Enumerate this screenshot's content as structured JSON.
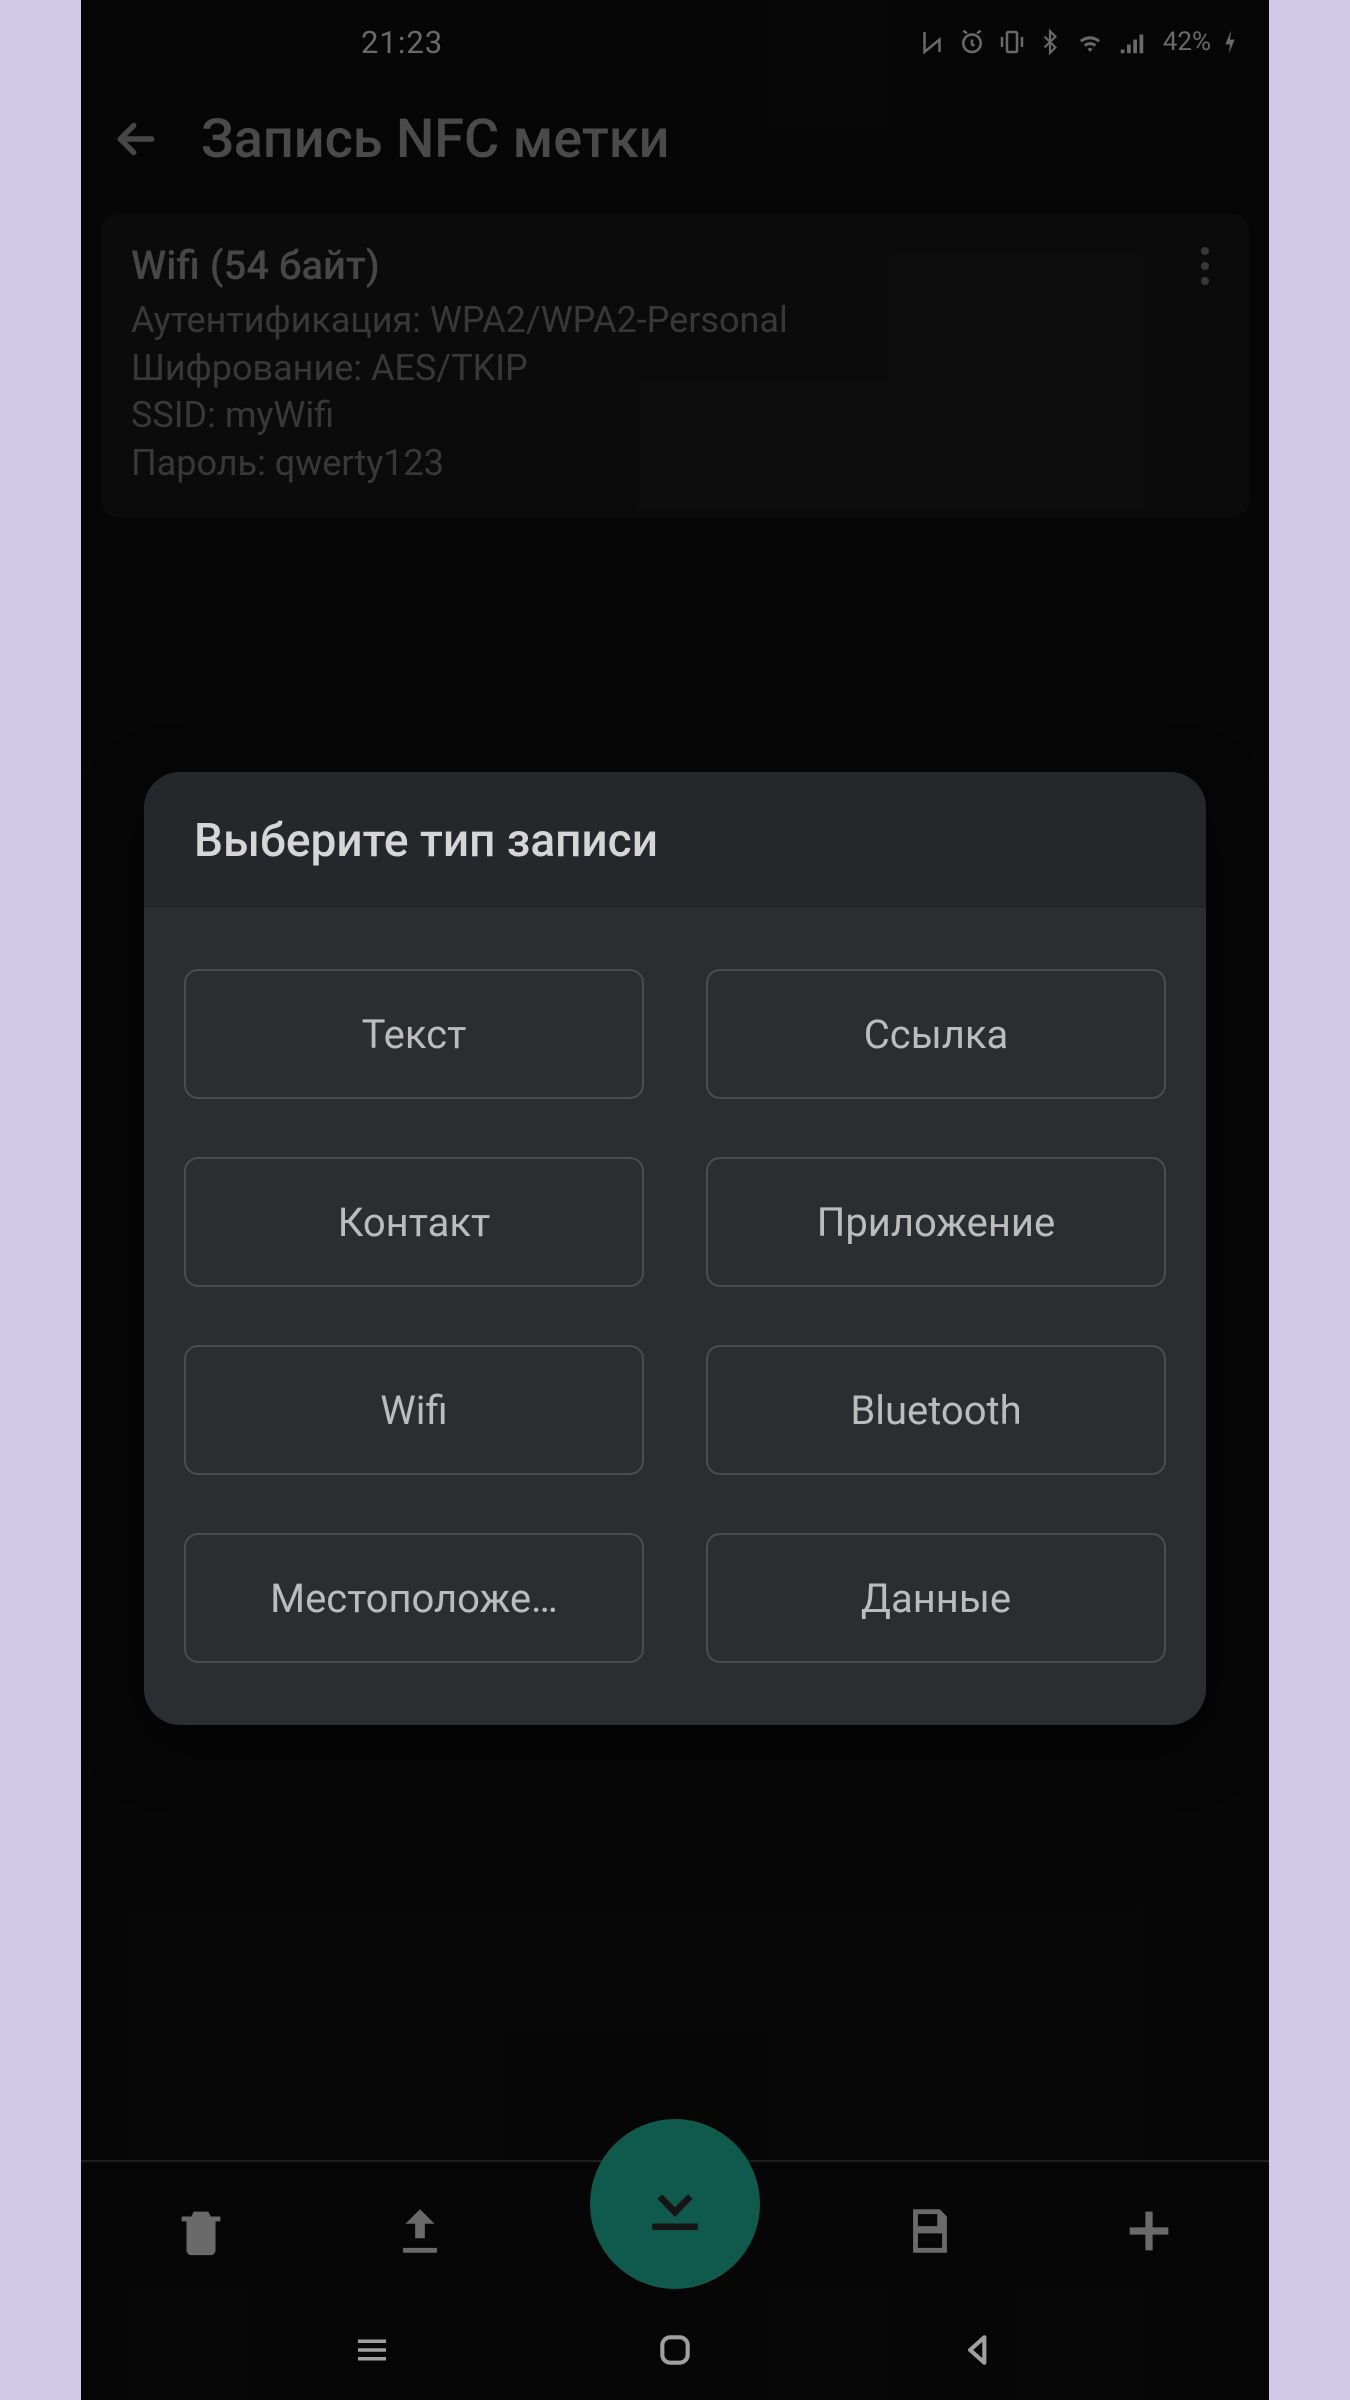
{
  "status": {
    "time": "21:23",
    "battery": "42%"
  },
  "appbar": {
    "title": "Запись NFC метки"
  },
  "card_wifi": {
    "title": "Wifi (54 байт)",
    "line1": "Аутентификация: WPA2/WPA2-Personal",
    "line2": "Шифрование: AES/TKIP",
    "line3": "SSID: myWifi",
    "line4": "Пароль: qwerty123"
  },
  "dialog": {
    "title": "Выберите тип записи",
    "options": {
      "text": "Текст",
      "link": "Ссылка",
      "contact": "Контакт",
      "app": "Приложение",
      "wifi": "Wifi",
      "bluetooth": "Bluetooth",
      "location": "Местоположе…",
      "data": "Данные"
    }
  }
}
